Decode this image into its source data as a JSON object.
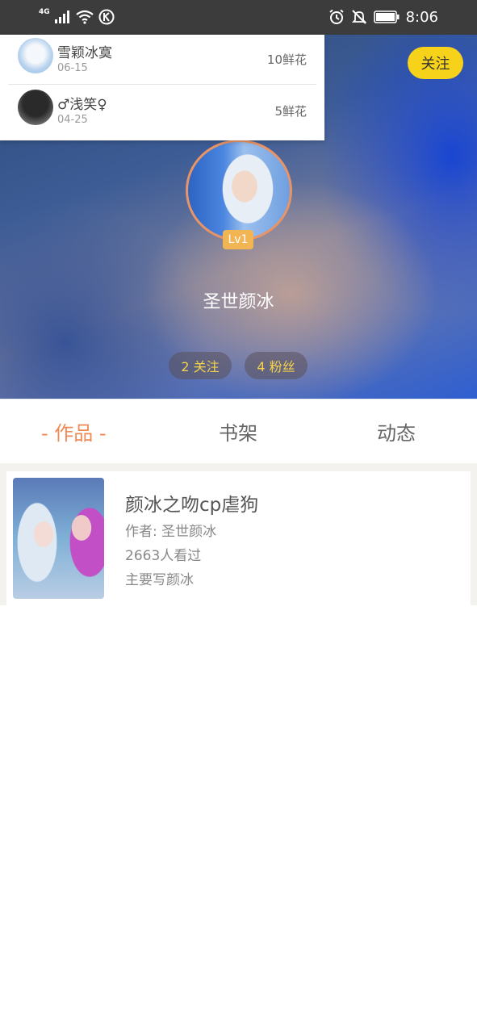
{
  "status_bar": {
    "network": "4G",
    "time": "8:06",
    "icons": [
      "signal-icon",
      "wifi-icon",
      "k-icon",
      "alarm-icon",
      "mute-icon",
      "battery-icon"
    ]
  },
  "header": {
    "follow_button": "关注",
    "level": "Lv1",
    "username": "圣世颜冰",
    "stats": {
      "following": "2 关注",
      "fans": "4 粉丝"
    }
  },
  "flower_list": [
    {
      "name": "雪颖冰寞",
      "date": "06-15",
      "amount": "10鲜花"
    },
    {
      "name": "♂浅笑♀",
      "date": "04-25",
      "amount": "5鲜花"
    }
  ],
  "tabs": [
    {
      "label": "- 作品 -",
      "active": true
    },
    {
      "label": "书架",
      "active": false
    },
    {
      "label": "动态",
      "active": false
    }
  ],
  "works": [
    {
      "title": "颜冰之吻cp虐狗",
      "author": "作者: 圣世颜冰",
      "views": "2663人看过",
      "description": "主要写颜冰"
    }
  ],
  "colors": {
    "accent_orange": "#ef8a56",
    "follow_yellow": "#f7d21a",
    "level_badge": "#f2b553"
  }
}
